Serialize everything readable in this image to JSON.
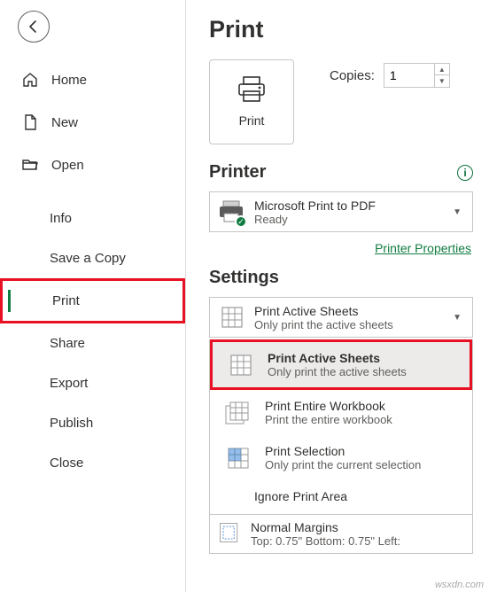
{
  "sidebar": {
    "home": "Home",
    "new": "New",
    "open": "Open",
    "info": "Info",
    "save_copy": "Save a Copy",
    "print": "Print",
    "share": "Share",
    "export": "Export",
    "publish": "Publish",
    "close": "Close"
  },
  "page": {
    "title": "Print",
    "print_btn": "Print",
    "copies_label": "Copies:",
    "copies_value": "1"
  },
  "printer": {
    "header": "Printer",
    "name": "Microsoft Print to PDF",
    "status": "Ready",
    "properties_link": "Printer Properties"
  },
  "settings": {
    "header": "Settings",
    "selected_title": "Print Active Sheets",
    "selected_sub": "Only print the active sheets",
    "options": [
      {
        "title": "Print Active Sheets",
        "sub": "Only print the active sheets"
      },
      {
        "title": "Print Entire Workbook",
        "sub": "Print the entire workbook"
      },
      {
        "title": "Print Selection",
        "sub": "Only print the current selection"
      }
    ],
    "ignore": "Ignore Print Area",
    "margins_title": "Normal Margins",
    "margins_sub": "Top: 0.75\" Bottom: 0.75\" Left:"
  },
  "watermark": "wsxdn.com"
}
